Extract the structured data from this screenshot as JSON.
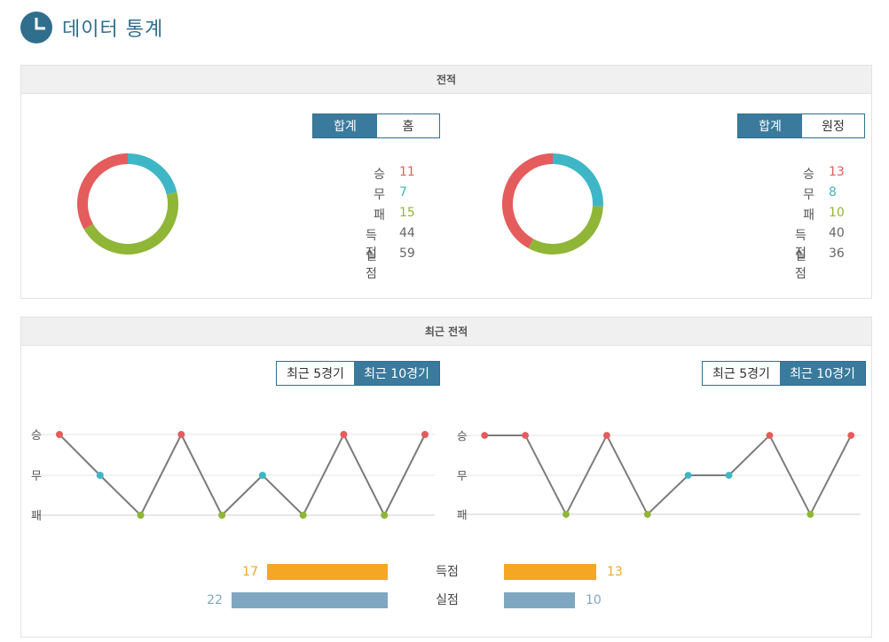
{
  "page": {
    "title": "데이터 통계",
    "icon": "pie-chart-icon"
  },
  "colors": {
    "accent": "#3a7a9c",
    "win": "#e55c5c",
    "draw": "#3fb6c6",
    "loss": "#8fb637",
    "goals": "#f5a623",
    "conceded": "#7fa7c2"
  },
  "record": {
    "header": "전적",
    "left": {
      "tabs": [
        {
          "label": "합계",
          "active": true
        },
        {
          "label": "홈",
          "active": false
        }
      ],
      "stats": [
        {
          "label": "승",
          "value": "11"
        },
        {
          "label": "무",
          "value": "7"
        },
        {
          "label": "패",
          "value": "15"
        },
        {
          "label": "득점",
          "value": "44"
        },
        {
          "label": "실점",
          "value": "59"
        }
      ]
    },
    "right": {
      "tabs": [
        {
          "label": "합계",
          "active": true
        },
        {
          "label": "원정",
          "active": false
        }
      ],
      "stats": [
        {
          "label": "승",
          "value": "13"
        },
        {
          "label": "무",
          "value": "8"
        },
        {
          "label": "패",
          "value": "10"
        },
        {
          "label": "득점",
          "value": "40"
        },
        {
          "label": "실점",
          "value": "36"
        }
      ]
    }
  },
  "recent": {
    "header": "최근 전적",
    "left": {
      "tabs": [
        {
          "label": "최근 5경기",
          "active": false
        },
        {
          "label": "최근 10경기",
          "active": true
        }
      ],
      "results": [
        "W",
        "D",
        "L",
        "W",
        "L",
        "D",
        "L",
        "W",
        "L",
        "W"
      ]
    },
    "right": {
      "tabs": [
        {
          "label": "최근 5경기",
          "active": false
        },
        {
          "label": "최근 10경기",
          "active": true
        }
      ],
      "results": [
        "W",
        "W",
        "L",
        "W",
        "L",
        "D",
        "D",
        "W",
        "L",
        "W"
      ]
    },
    "axis_labels": [
      "승",
      "무",
      "패"
    ],
    "goals": {
      "label": "득점",
      "left": "17",
      "right": "13"
    },
    "conceded": {
      "label": "실점",
      "left": "22",
      "right": "10"
    }
  }
}
